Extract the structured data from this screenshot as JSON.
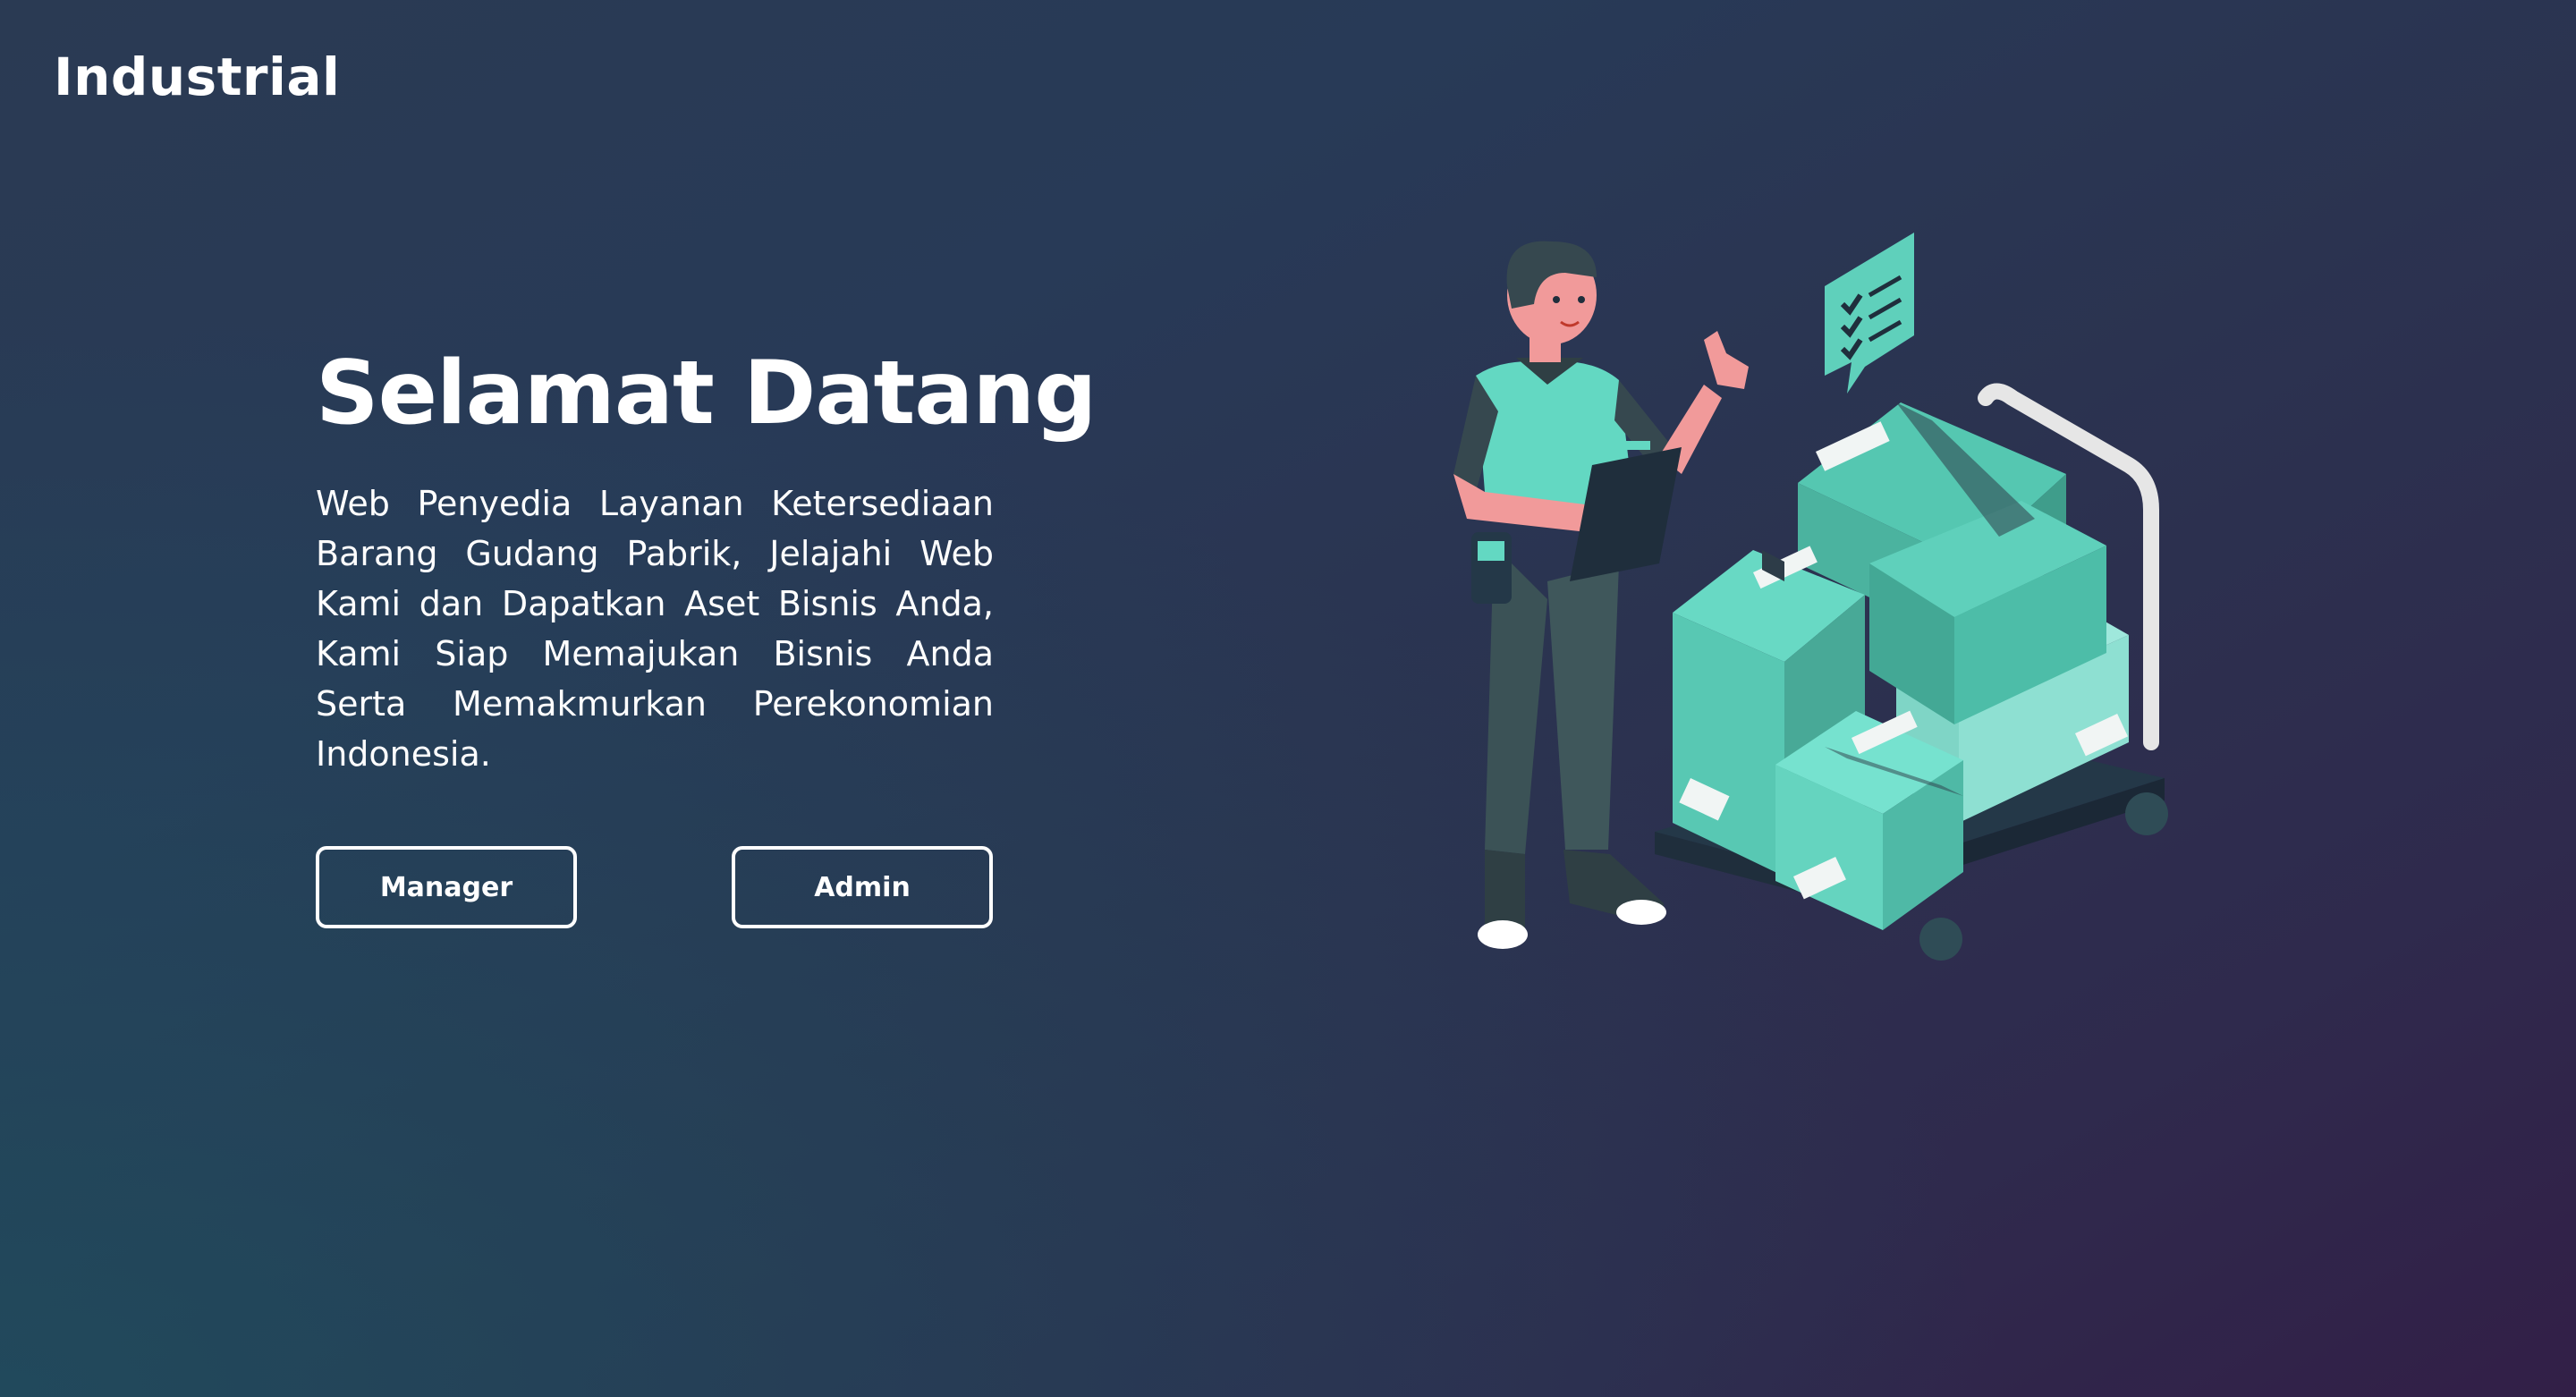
{
  "brand": {
    "title": "Industrial"
  },
  "hero": {
    "heading": "Selamat Datang",
    "description": "Web Penyedia Layanan Ketersediaan Barang Gudang Pabrik, Jelajahi Web Kami dan Dapatkan Aset Bisnis Anda, Kami Siap Memajukan Bisnis Anda Serta Memakmurkan Perekonomian Indonesia."
  },
  "buttons": {
    "manager_label": "Manager",
    "admin_label": "Admin"
  },
  "illustration": {
    "icon": "warehouse-worker-boxes-illustration"
  },
  "colors": {
    "accent": "#63d8c2",
    "accent_dark": "#3fae9b",
    "text": "#ffffff"
  }
}
